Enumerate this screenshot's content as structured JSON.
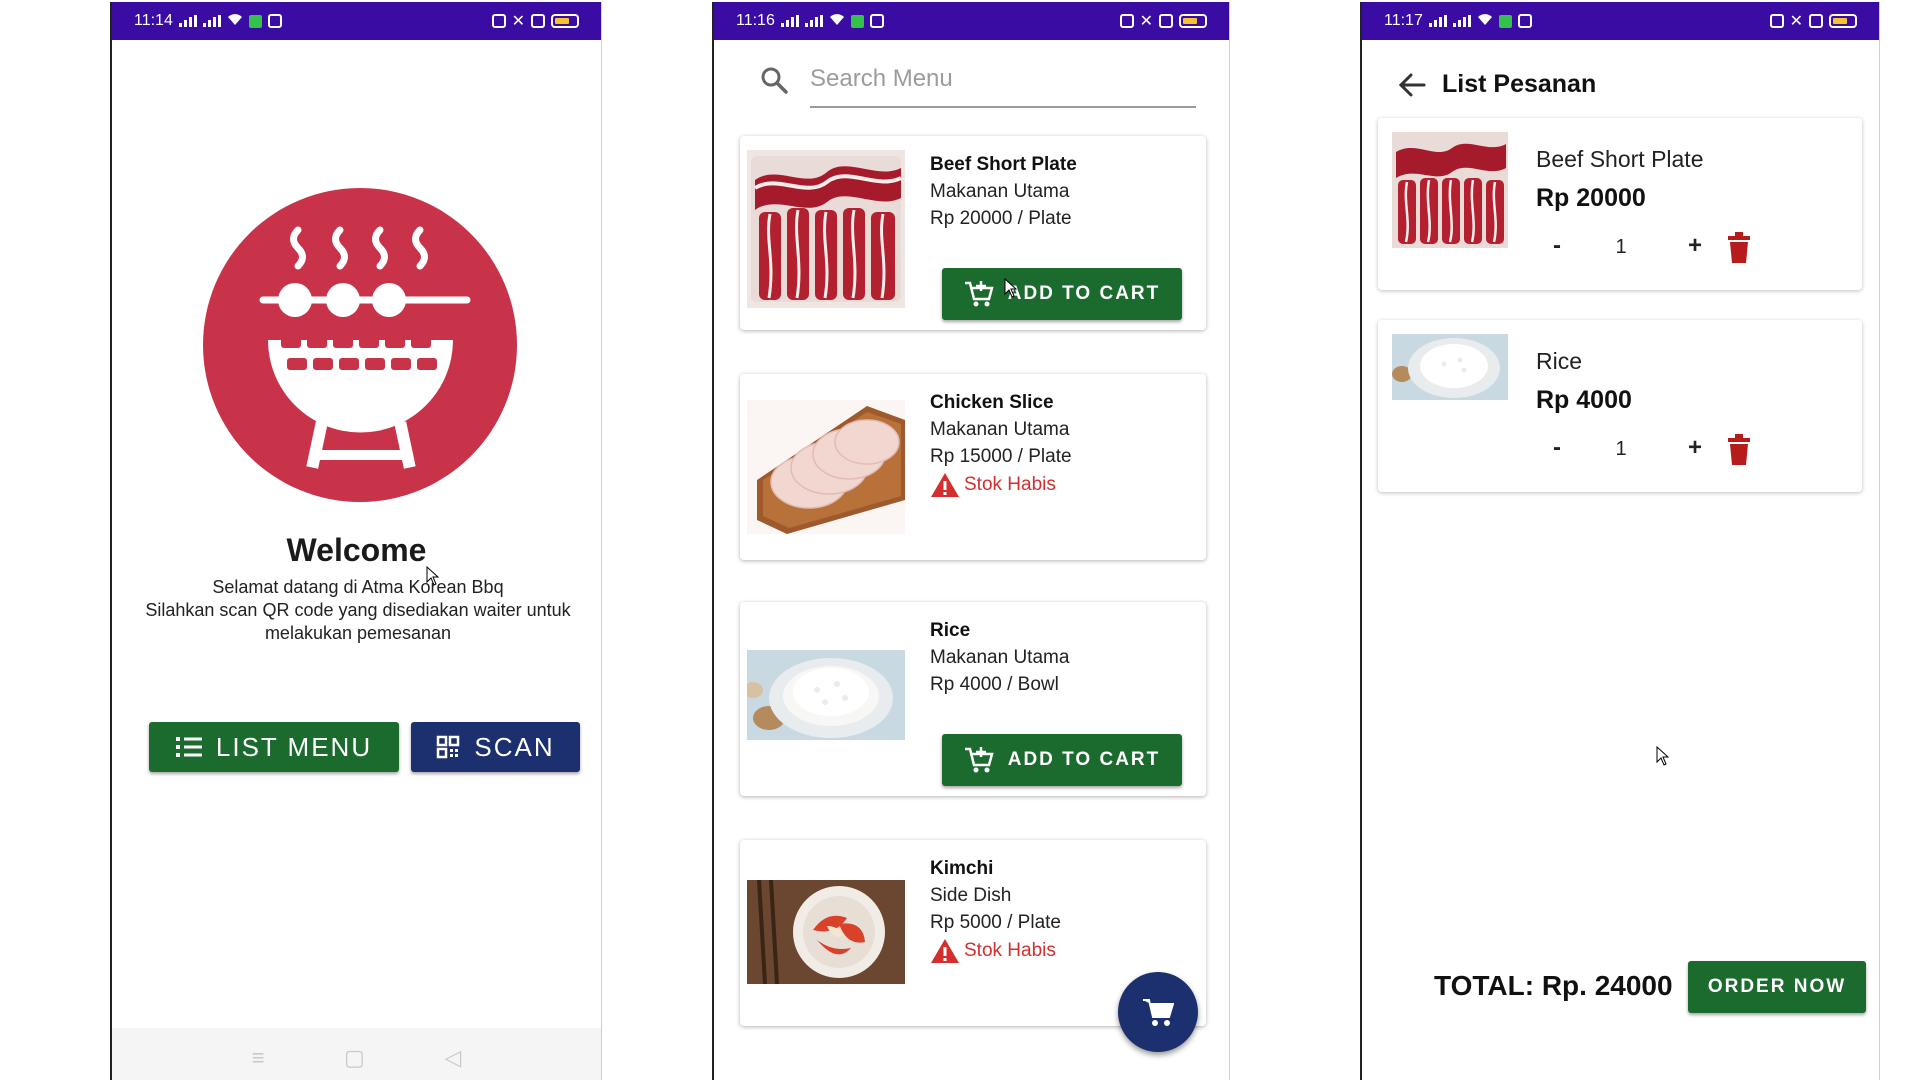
{
  "screen1": {
    "status_time": "11:14",
    "welcome_title": "Welcome",
    "welcome_line1": "Selamat datang di Atma Korean Bbq",
    "welcome_line2": "Silahkan scan QR code yang disediakan waiter untuk melakukan pemesanan",
    "list_menu_label": "LIST MENU",
    "scan_label": "SCAN",
    "nav_menu_icon": "≡",
    "nav_home_icon": "▢",
    "nav_back_icon": "◁"
  },
  "screen2": {
    "status_time": "11:16",
    "search_placeholder": "Search Menu",
    "items": [
      {
        "name": "Beef Short Plate",
        "category": "Makanan Utama",
        "price": "Rp 20000 / Plate",
        "available": true
      },
      {
        "name": "Chicken Slice",
        "category": "Makanan Utama",
        "price": "Rp 15000 / Plate",
        "available": false
      },
      {
        "name": "Rice",
        "category": "Makanan Utama",
        "price": "Rp 4000 / Bowl",
        "available": true
      },
      {
        "name": "Kimchi",
        "category": "Side Dish",
        "price": "Rp 5000 / Plate",
        "available": false
      }
    ],
    "add_to_cart_label": "ADD TO CART",
    "stok_habis_label": "Stok Habis"
  },
  "screen3": {
    "status_time": "11:17",
    "title": "List Pesanan",
    "orders": [
      {
        "name": "Beef Short Plate",
        "price": "Rp 20000",
        "qty": "1"
      },
      {
        "name": "Rice",
        "price": "Rp 4000",
        "qty": "1"
      }
    ],
    "minus_label": "-",
    "plus_label": "+",
    "total": "TOTAL: Rp. 24000",
    "order_now_label": "ORDER NOW"
  },
  "colors": {
    "status_bar": "#3a0ca3",
    "primary_green": "#1b6b2f",
    "navy": "#1c2f6e",
    "logo_red": "#c8334a",
    "warning_red": "#d32f2f",
    "delete_red": "#b71c1c"
  }
}
